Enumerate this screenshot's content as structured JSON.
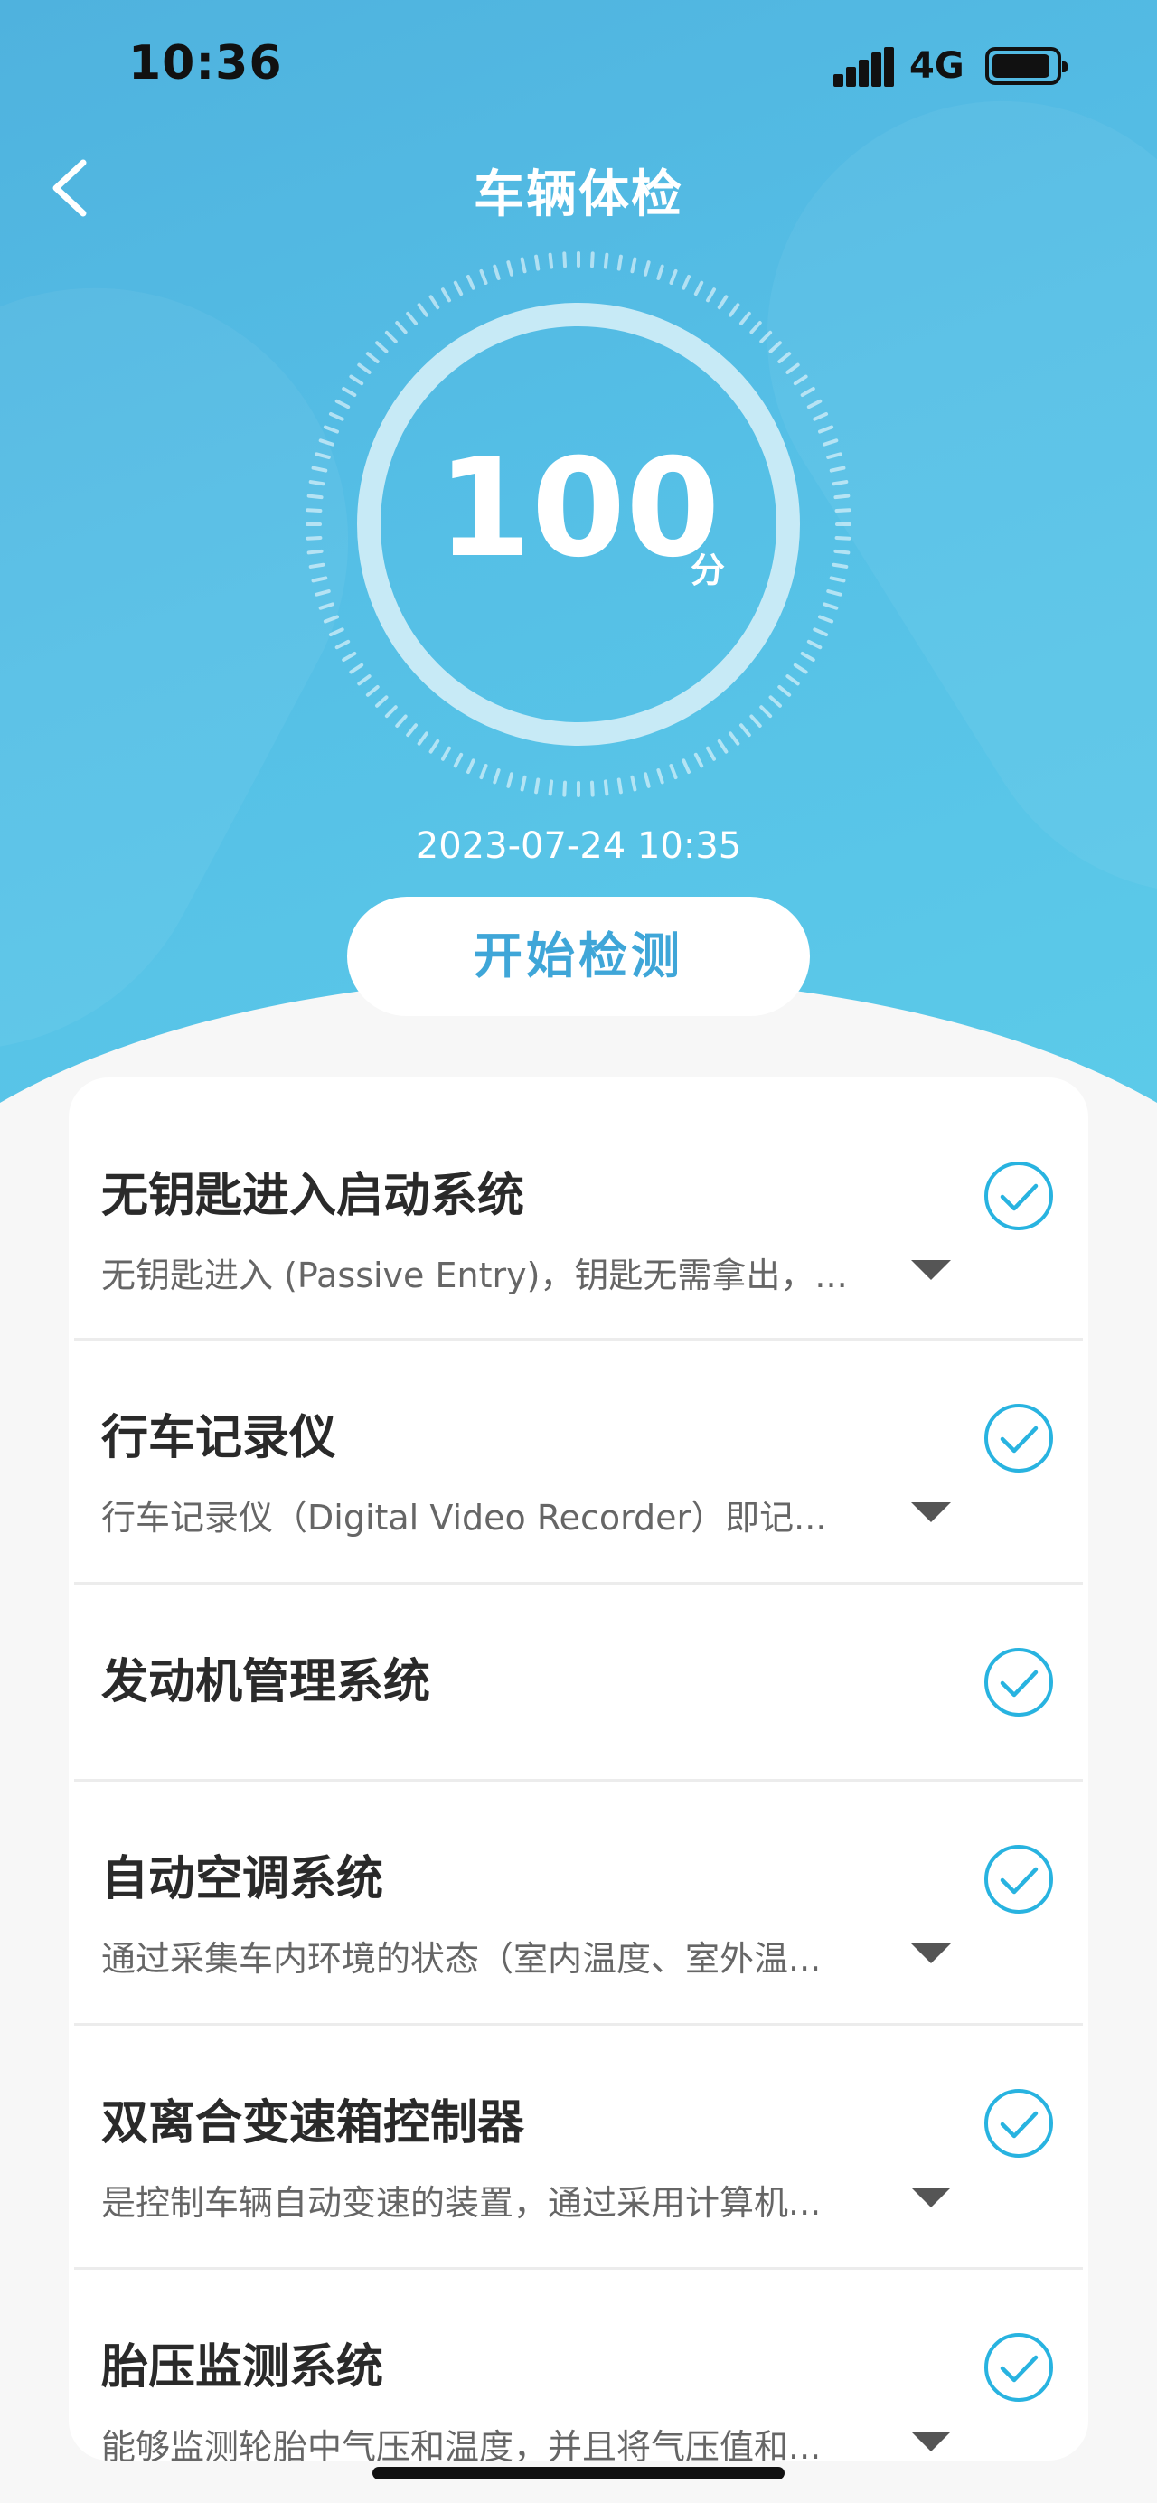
{
  "status_bar": {
    "time": "10:36",
    "network": "4G"
  },
  "header": {
    "title": "车辆体检"
  },
  "score": {
    "value": "100",
    "unit": "分",
    "timestamp": "2023-07-24 10:35"
  },
  "actions": {
    "start_label": "开始检测"
  },
  "items": [
    {
      "title": "无钥匙进入启动系统",
      "desc": "无钥匙进入 (Passive Entry)，钥匙无需拿出，...",
      "checked": true,
      "expandable": true
    },
    {
      "title": "行车记录仪",
      "desc": "行车记录仪（Digital Video Recorder）即记...",
      "checked": true,
      "expandable": true
    },
    {
      "title": "发动机管理系统",
      "desc": "",
      "checked": true,
      "expandable": false
    },
    {
      "title": "自动空调系统",
      "desc": "通过采集车内环境的状态（室内温度、室外温...",
      "checked": true,
      "expandable": true
    },
    {
      "title": "双离合变速箱控制器",
      "desc": "是控制车辆自动变速的装置，通过采用计算机...",
      "checked": true,
      "expandable": true
    },
    {
      "title": "胎压监测系统",
      "desc": "能够监测轮胎中气压和温度，并且将气压值和...",
      "checked": true,
      "expandable": true
    }
  ],
  "colors": {
    "accent": "#28b3e0",
    "hero": "#55bfe6",
    "button_text": "#3fa6d8"
  },
  "icons": {
    "back": "chevron-left-icon",
    "check": "check-circle-icon",
    "expand": "caret-down-icon"
  }
}
